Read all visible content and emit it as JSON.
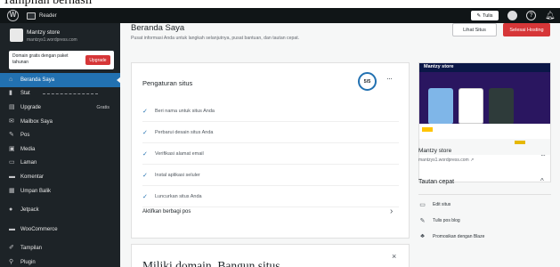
{
  "title_strip": "Tampilan berhasil",
  "adminbar": {
    "reader_label": "Reader",
    "tulis_label": "Tulis",
    "help_glyph": "?",
    "bell_glyph": "♫"
  },
  "sidebar": {
    "site_name": "Mantzy store",
    "site_url": "mantzys1.wordpress.com",
    "upgrade_text": "Domain gratis dengan paket tahunan",
    "upgrade_button": "Upgrade",
    "items": [
      {
        "label": "Beranda Saya",
        "icon": "home-icon",
        "glyph": "⌂",
        "active": true
      },
      {
        "label": "Stat",
        "icon": "stats-icon",
        "glyph": "▮",
        "dashes": true
      },
      {
        "label": "Upgrade",
        "icon": "upgrade-icon",
        "glyph": "▤",
        "right": "Gratis"
      },
      {
        "label": "Mailbox Saya",
        "icon": "mail-icon",
        "glyph": "✉"
      },
      {
        "label": "Pos",
        "icon": "pin-icon",
        "glyph": "✎"
      },
      {
        "label": "Media",
        "icon": "media-icon",
        "glyph": "▣"
      },
      {
        "label": "Laman",
        "icon": "page-icon",
        "glyph": "▭"
      },
      {
        "label": "Komentar",
        "icon": "comment-icon",
        "glyph": "▬"
      },
      {
        "label": "Umpan Balik",
        "icon": "feedback-icon",
        "glyph": "▦"
      },
      {
        "label": "Jetpack",
        "icon": "jetpack-icon",
        "glyph": "●",
        "gap": true
      },
      {
        "label": "WooCommerce",
        "icon": "woo-icon",
        "glyph": "▬",
        "gap": true
      },
      {
        "label": "Tampilan",
        "icon": "appearance-icon",
        "glyph": "✐",
        "gap": true
      },
      {
        "label": "Plugin",
        "icon": "plugin-icon",
        "glyph": "⚲"
      }
    ]
  },
  "main": {
    "title": "Beranda Saya",
    "subtitle": "Pusat informasi Anda untuk langkah selanjutnya, pusat bantuan, dan tautan cepat.",
    "btn_lihat": "Lihat Situs",
    "btn_selesai": "Selesai Hosting",
    "setup": {
      "title": "Pengaturan situs",
      "progress": "5/5",
      "more": "···",
      "tasks": [
        "Beri nama untuk situs Anda",
        "Perbarui desain situs Anda",
        "Verifikasi alamat email",
        "Instal aplikasi seluler",
        "Luncurkan situs Anda"
      ],
      "link": "Aktifkan berbagi pos",
      "chevron": "›"
    },
    "domain": {
      "title": "Miliki domain. Bangun situs.",
      "close": "×"
    },
    "preview": {
      "store_brand": "Mantzy store",
      "name": "Mantzy store",
      "url": "mantzys1.wordpress.com ↗",
      "more": "···"
    },
    "quick": {
      "title": "Tautan cepat",
      "chevron": "^",
      "links": [
        {
          "label": "Edit situs",
          "icon": "edit-site-icon",
          "glyph": "▭"
        },
        {
          "label": "Tulis pos blog",
          "icon": "write-icon",
          "glyph": "✎"
        },
        {
          "label": "Promosikan dengan Blaze",
          "icon": "blaze-icon",
          "glyph": "♣"
        }
      ]
    }
  }
}
